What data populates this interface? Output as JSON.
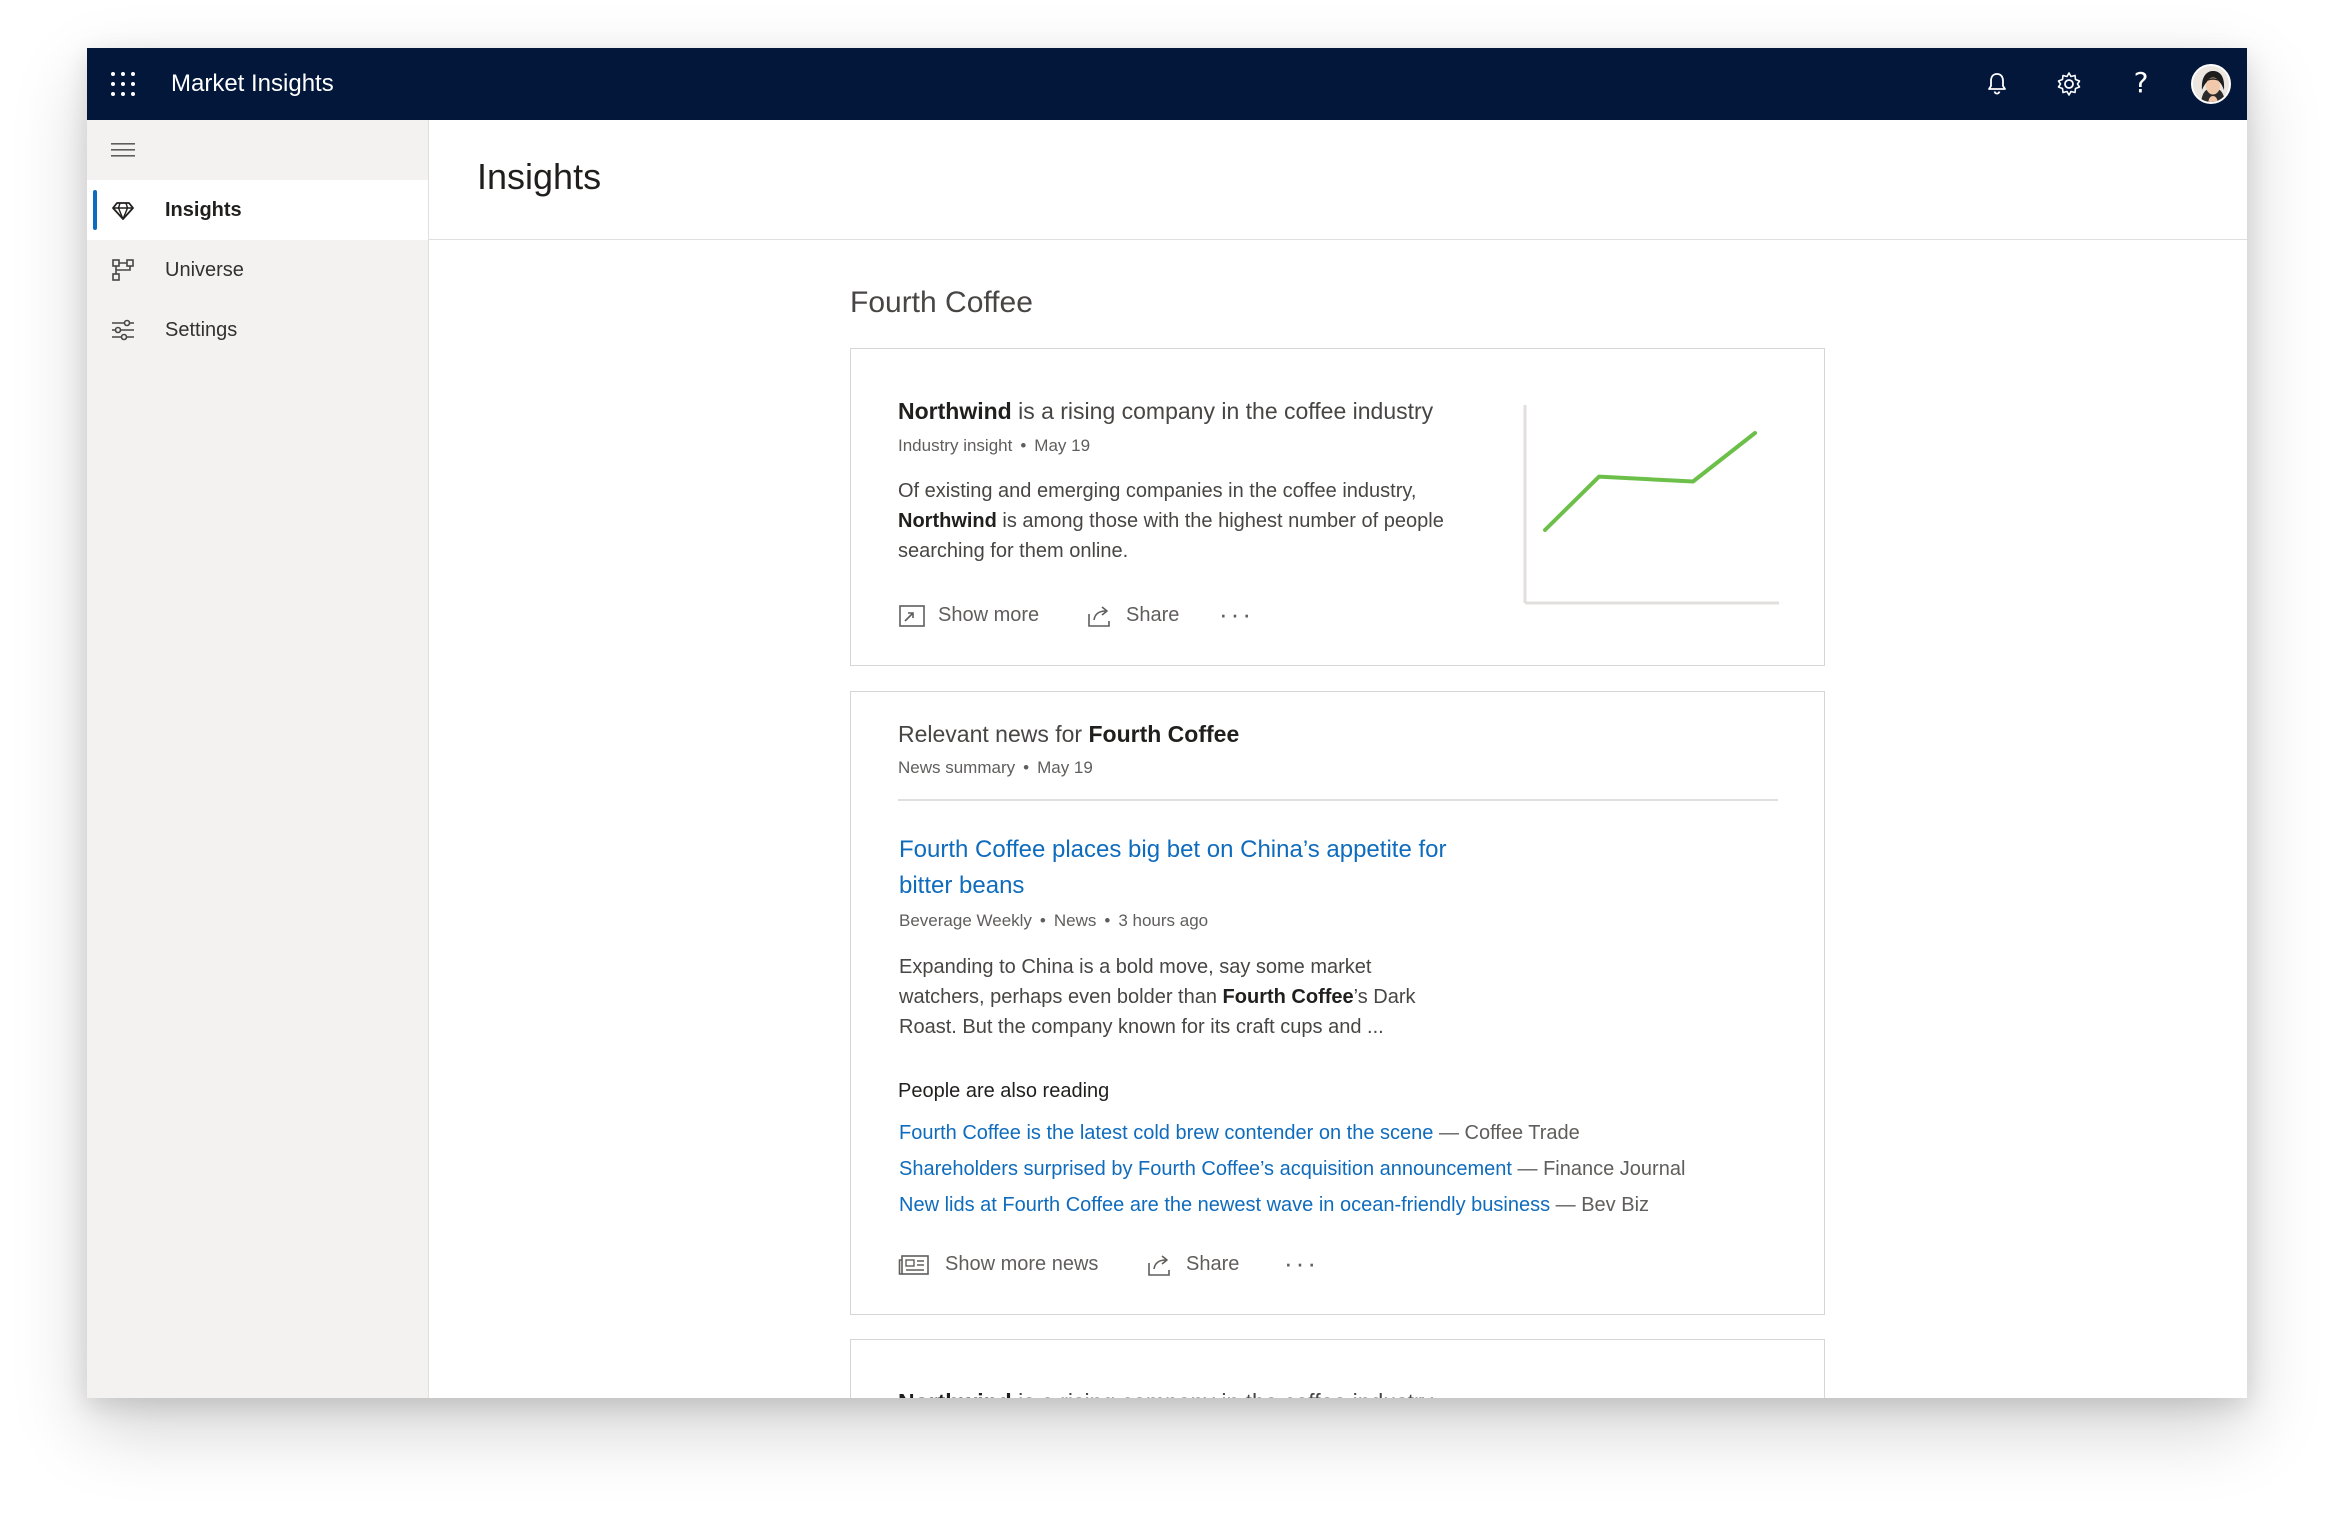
{
  "app": {
    "title": "Market Insights"
  },
  "topbar": {
    "icons": [
      "bell-icon",
      "gear-icon",
      "help-icon"
    ],
    "help_glyph": "?"
  },
  "sidebar": {
    "items": [
      {
        "label": "Insights",
        "icon": "diamond-icon",
        "active": true
      },
      {
        "label": "Universe",
        "icon": "hierarchy-icon",
        "active": false
      },
      {
        "label": "Settings",
        "icon": "sliders-icon",
        "active": false
      }
    ]
  },
  "page": {
    "title": "Insights",
    "section_title": "Fourth Coffee"
  },
  "insight_card": {
    "title_bold": "Northwind",
    "title_rest": " is a rising company in the coffee industry",
    "meta_type": "Industry insight",
    "meta_date": "May 19",
    "desc_before": "Of existing and emerging companies in the coffee industry,",
    "desc_bold": "Northwind",
    "desc_after": " is among those with the highest number of people searching for them online.",
    "actions": {
      "show_more": "Show more",
      "share": "Share",
      "more": "···"
    },
    "sparkline": {
      "values": [
        0,
        0.55,
        0.5,
        1.0
      ],
      "color": "#6cc04a"
    }
  },
  "news_card": {
    "title_prefix": "Relevant news for ",
    "title_bold": "Fourth Coffee",
    "meta_type": "News summary",
    "meta_date": "May 19",
    "headline": "Fourth Coffee places big bet on China’s appetite for bitter beans",
    "article_meta": {
      "source": "Beverage Weekly",
      "category": "News",
      "time": "3 hours ago"
    },
    "excerpt_before": "Expanding to China is a bold move, say some market watchers, perhaps even bolder than ",
    "excerpt_bold": "Fourth Coffee",
    "excerpt_after": "’s Dark Roast. But the company known for its craft cups and ...",
    "also_reading_title": "People are also reading",
    "also_reading": [
      {
        "title": "Fourth Coffee is the latest cold brew contender on the scene",
        "source": " — Coffee Trade"
      },
      {
        "title": "Shareholders surprised by Fourth Coffee’s acquisition announcement",
        "source": " — Finance Journal"
      },
      {
        "title": "New lids at Fourth Coffee are the newest wave in ocean-friendly business",
        "source": " — Bev Biz"
      }
    ],
    "actions": {
      "show_more": "Show more news",
      "share": "Share",
      "more": "···"
    }
  },
  "next_card": {
    "title_bold": "Northwind",
    "title_rest": " is a rising company in the coffee industry"
  },
  "colors": {
    "topbar": "#03173b",
    "accent": "#0f6cbd",
    "link": "#0f6cbd",
    "sparkline": "#6cc04a"
  }
}
